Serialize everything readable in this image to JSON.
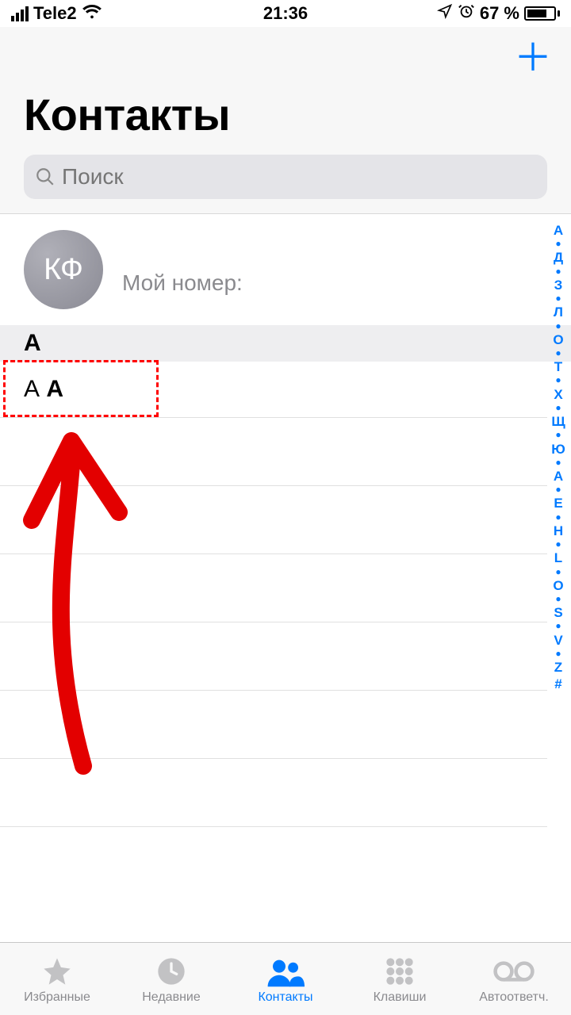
{
  "status": {
    "carrier": "Tele2",
    "time": "21:36",
    "battery_pct": "67 %"
  },
  "header": {
    "title": "Контакты"
  },
  "search": {
    "placeholder": "Поиск"
  },
  "me": {
    "initials": "КФ",
    "label": "Мой номер:"
  },
  "section": {
    "letter": "А"
  },
  "contacts": [
    {
      "first": "А",
      "last": "А"
    }
  ],
  "index": [
    "А",
    "●",
    "Д",
    "●",
    "З",
    "●",
    "Л",
    "●",
    "О",
    "●",
    "Т",
    "●",
    "Х",
    "●",
    "Щ",
    "●",
    "Ю",
    "●",
    "A",
    "●",
    "E",
    "●",
    "H",
    "●",
    "L",
    "●",
    "O",
    "●",
    "S",
    "●",
    "V",
    "●",
    "Z",
    "#"
  ],
  "tabs": {
    "favorites": "Избранные",
    "recents": "Недавние",
    "contacts": "Контакты",
    "keypad": "Клавиши",
    "voicemail": "Автоответч."
  }
}
